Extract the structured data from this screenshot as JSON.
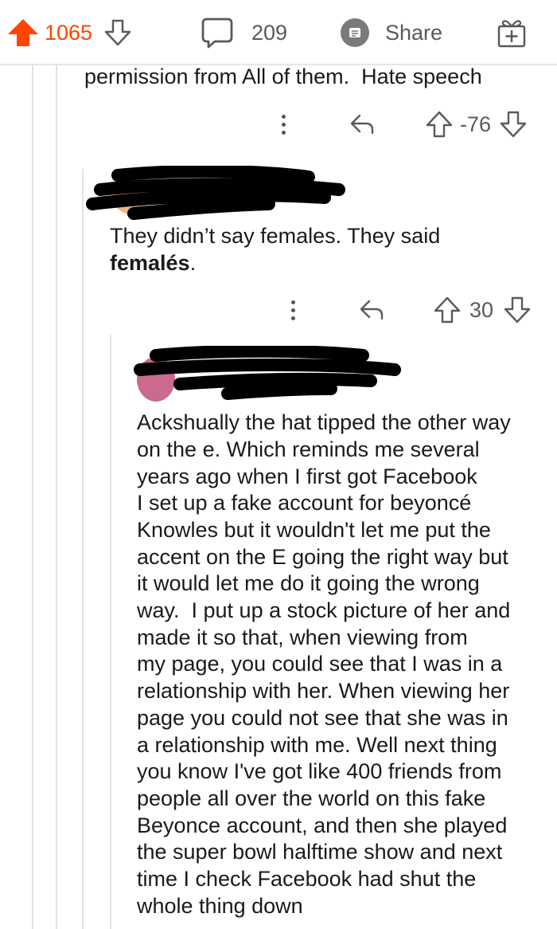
{
  "topbar": {
    "upvotes": "1065",
    "comments": "209",
    "share_label": "Share"
  },
  "comments": [
    {
      "text_lines": [
        "permission from All of them.  Hate speech"
      ],
      "score": "-76"
    },
    {
      "text_lines": [
        "They didn’t say females. They said"
      ],
      "bold_text": "femalés",
      "trailing_text": ".",
      "score": "30"
    },
    {
      "text_lines": [
        "Ackshually the hat tipped the other way",
        "on the e. Which reminds me several",
        "years ago when I first got Facebook",
        "I set up a fake account for beyoncé",
        "Knowles but it wouldn't let me put the",
        "accent on the E going the right way but",
        "it would let me do it going the wrong",
        "way.  I put up a stock picture of her and",
        "made it so that, when viewing from",
        "my page, you could see that I was in a",
        "relationship with her. When viewing her",
        "page you could not see that she was in",
        "a relationship with me. Well next thing",
        "you know I've got like 400 friends from",
        "people all over the world on this fake",
        "Beyonce account, and then she played",
        "the super bowl halftime show and next",
        "time I check Facebook had shut the",
        "whole thing down"
      ]
    }
  ],
  "colors": {
    "upvote_active": "#ff4500",
    "icon_gray": "#5a5a5a",
    "thread_line": "#e3e3e3",
    "redaction": "#000000"
  },
  "icons": [
    "upvote-filled-icon",
    "downvote-icon",
    "comment-bubble-icon",
    "share-icon",
    "gift-award-icon",
    "more-options-icon",
    "reply-icon",
    "upvote-icon"
  ]
}
